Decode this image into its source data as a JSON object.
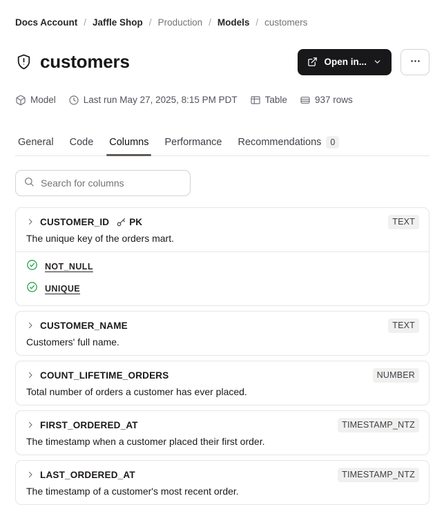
{
  "breadcrumb": {
    "separator": "/",
    "items": [
      {
        "label": "Docs Account"
      },
      {
        "label": "Jaffle Shop"
      },
      {
        "label": "Production"
      },
      {
        "label": "Models"
      },
      {
        "label": "customers"
      }
    ]
  },
  "header": {
    "title": "customers",
    "open_in_button": "Open in..."
  },
  "meta": {
    "resource_type": "Model",
    "last_run": "Last run May 27, 2025, 8:15 PM PDT",
    "materialization": "Table",
    "row_count": "937 rows"
  },
  "tabs": {
    "general": "General",
    "code": "Code",
    "columns": "Columns",
    "performance": "Performance",
    "recommendations": "Recommendations",
    "recommendations_count": "0"
  },
  "search": {
    "placeholder": "Search for columns",
    "value": ""
  },
  "columns": [
    {
      "name": "CUSTOMER_ID",
      "pk_label": "PK",
      "type": "TEXT",
      "description": "The unique key of the orders mart.",
      "tests": [
        "NOT_NULL",
        "UNIQUE"
      ]
    },
    {
      "name": "CUSTOMER_NAME",
      "type": "TEXT",
      "description": "Customers' full name."
    },
    {
      "name": "COUNT_LIFETIME_ORDERS",
      "type": "NUMBER",
      "description": "Total number of orders a customer has ever placed."
    },
    {
      "name": "FIRST_ORDERED_AT",
      "type": "TIMESTAMP_NTZ",
      "description": "The timestamp when a customer placed their first order."
    },
    {
      "name": "LAST_ORDERED_AT",
      "type": "TIMESTAMP_NTZ",
      "description": "The timestamp of a customer's most recent order."
    }
  ],
  "colors": {
    "primary_button_bg": "#18181b",
    "success_green": "#2da44e",
    "badge_bg": "#f0f0ef",
    "card_border": "#e7e5e4",
    "active_tab_underline": "#5f5a54"
  }
}
